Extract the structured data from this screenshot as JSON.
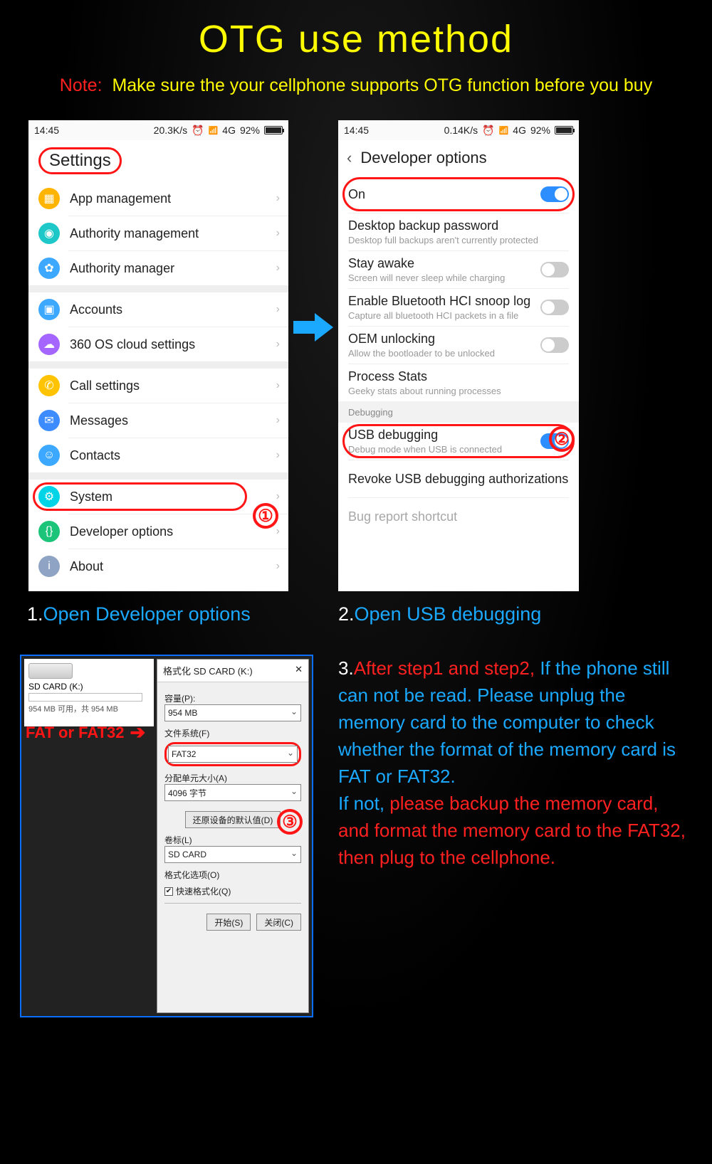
{
  "title": "OTG use method",
  "note": {
    "label": "Note:",
    "text": "Make sure the your cellphone supports OTG function before you buy"
  },
  "status": {
    "time": "14:45",
    "speed1": "20.3K/s",
    "speed2": "0.14K/s",
    "net": "4G",
    "pct": "92%"
  },
  "p1": {
    "header": "Settings",
    "rows": [
      {
        "label": "App management",
        "color": "c-orange",
        "glyph": "▦"
      },
      {
        "label": "Authority management",
        "color": "c-teal",
        "glyph": "◉"
      },
      {
        "label": "Authority manager",
        "color": "c-blue",
        "glyph": "✿"
      }
    ],
    "rows2": [
      {
        "label": "Accounts",
        "color": "c-blue",
        "glyph": "▣"
      },
      {
        "label": "360 OS cloud settings",
        "color": "c-purple",
        "glyph": "☁"
      }
    ],
    "rows3": [
      {
        "label": "Call settings",
        "color": "c-yellow",
        "glyph": "✆"
      },
      {
        "label": "Messages",
        "color": "c-blue2",
        "glyph": "✉"
      },
      {
        "label": "Contacts",
        "color": "c-blue",
        "glyph": "☺"
      }
    ],
    "rows4": [
      {
        "label": "System",
        "color": "c-cyan",
        "glyph": "⚙",
        "ring": true
      },
      {
        "label": "Developer options",
        "color": "c-green",
        "glyph": "{}"
      },
      {
        "label": "About",
        "color": "c-gray",
        "glyph": "i"
      }
    ]
  },
  "p2": {
    "header": "Developer options",
    "rows": [
      {
        "lbl": "On",
        "toggle": "on",
        "ring": true
      },
      {
        "lbl": "Desktop backup password",
        "sub": "Desktop full backups aren't currently protected"
      },
      {
        "lbl": "Stay awake",
        "sub": "Screen will never sleep while charging",
        "toggle": "off"
      },
      {
        "lbl": "Enable Bluetooth HCI snoop log",
        "sub": "Capture all bluetooth HCI packets in a file",
        "toggle": "off"
      },
      {
        "lbl": "OEM unlocking",
        "sub": "Allow the bootloader to be unlocked",
        "toggle": "off"
      },
      {
        "lbl": "Process Stats",
        "sub": "Geeky stats about running processes"
      }
    ],
    "section": "Debugging",
    "rows2": [
      {
        "lbl": "USB debugging",
        "sub": "Debug mode when USB is connected",
        "toggle": "on",
        "ring": true
      },
      {
        "lbl": "Revoke USB debugging authorizations"
      },
      {
        "lbl": "Bug report shortcut",
        "fade": true
      }
    ]
  },
  "cap1": {
    "num": "1.",
    "txt": "Open Developer options"
  },
  "cap2": {
    "num": "2.",
    "txt": "Open USB debugging"
  },
  "fmt": {
    "sd_title": "SD CARD (K:)",
    "sd_sub": "954 MB 可用，共 954 MB",
    "dlg_title": "格式化 SD CARD (K:)",
    "cap_lbl": "容量(P):",
    "cap_val": "954 MB",
    "fs_lbl": "文件系统(F)",
    "fs_val": "FAT32",
    "unit_lbl": "分配单元大小(A)",
    "unit_val": "4096 字节",
    "restore": "还原设备的默认值(D)",
    "vol_lbl": "卷标(L)",
    "vol_val": "SD CARD",
    "opt_lbl": "格式化选项(O)",
    "quick": "快速格式化(Q)",
    "start": "开始(S)",
    "close": "关闭(C)",
    "fat_label": "FAT or FAT32"
  },
  "step3": {
    "a": "3.",
    "b": "After step1 and step2,",
    "c": "If the phone still can not be read. Please unplug the memory card to the computer to check whether the format of the memory card is FAT or FAT32.",
    "d": "If not, ",
    "e": "please backup the memory card, and format the memory card to the FAT32, then plug to the cellphone."
  },
  "marks": {
    "one": "①",
    "two": "②",
    "three": "③"
  }
}
